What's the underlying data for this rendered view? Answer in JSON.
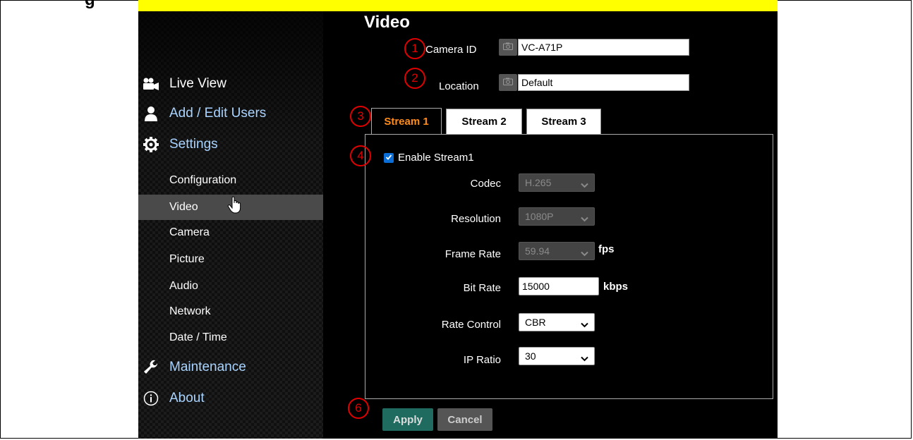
{
  "doc": {
    "heading_fragment": "g"
  },
  "sidebar": {
    "main_items": [
      {
        "label": "Live View",
        "icon": "video-camera-icon"
      },
      {
        "label": "Add / Edit Users",
        "icon": "user-icon"
      },
      {
        "label": "Settings",
        "icon": "gear-icon"
      },
      {
        "label": "Maintenance",
        "icon": "wrench-icon"
      },
      {
        "label": "About",
        "icon": "info-icon"
      }
    ],
    "sub_items": [
      "Configuration",
      "Video",
      "Camera",
      "Picture",
      "Audio",
      "Network",
      "Date / Time"
    ],
    "active_sub": "Video"
  },
  "main": {
    "title": "Video",
    "camera_id": {
      "label": "Camera ID",
      "value": "VC-A71P"
    },
    "location": {
      "label": "Location",
      "value": "Default"
    },
    "tabs": [
      {
        "label": "Stream 1",
        "active": true
      },
      {
        "label": "Stream 2",
        "active": false
      },
      {
        "label": "Stream 3",
        "active": false
      }
    ],
    "enable_stream": {
      "label": "Enable Stream1",
      "checked": true
    },
    "form": {
      "codec": {
        "label": "Codec",
        "value": "H.265"
      },
      "resolution": {
        "label": "Resolution",
        "value": "1080P"
      },
      "frame_rate": {
        "label": "Frame Rate",
        "value": "59.94",
        "unit": "fps"
      },
      "bit_rate": {
        "label": "Bit Rate",
        "value": "15000",
        "unit": "kbps"
      },
      "rate_control": {
        "label": "Rate Control",
        "value": "CBR"
      },
      "ip_ratio": {
        "label": "IP Ratio",
        "value": "30"
      }
    },
    "apply_label": "Apply",
    "cancel_label": "Cancel"
  },
  "callouts": [
    "1",
    "2",
    "3",
    "4",
    "6"
  ],
  "colors": {
    "highlight_bar": "#ffff00",
    "active_tab_text": "#ff8c1a",
    "callout": "#e00000",
    "apply_button": "#1f6b5f",
    "cancel_button": "#555555",
    "checkbox": "#0b6ed6",
    "nav_link": "#a9d4ff"
  }
}
